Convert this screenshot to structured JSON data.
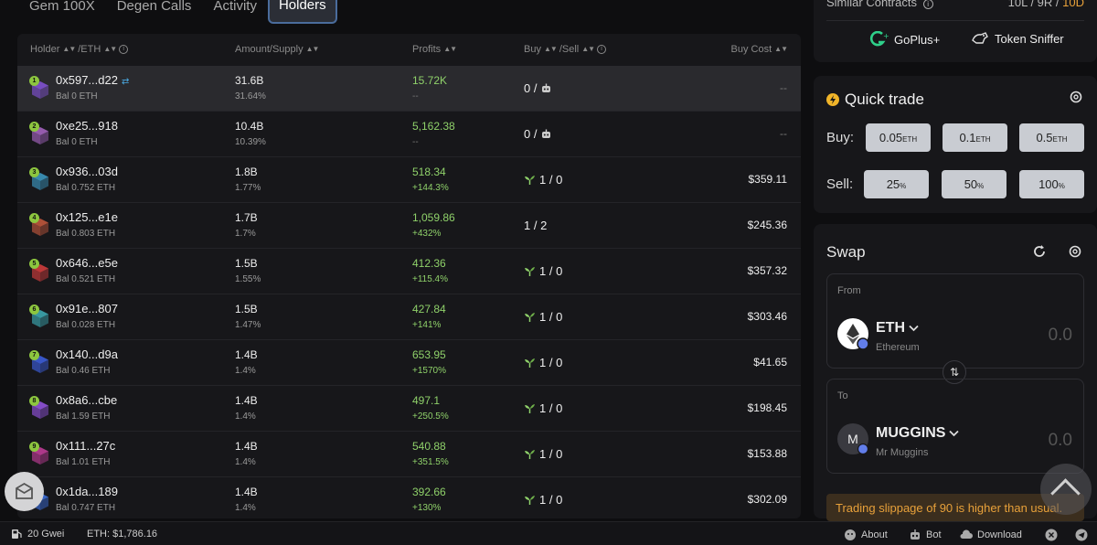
{
  "tabs": [
    {
      "label": "Gem 100X",
      "active": false
    },
    {
      "label": "Degen Calls",
      "active": false
    },
    {
      "label": "Activity",
      "active": false
    },
    {
      "label": "Holders",
      "active": true
    }
  ],
  "table": {
    "headers": {
      "holder": "Holder",
      "eth": "/ETH",
      "amount": "Amount/Supply",
      "profits": "Profits",
      "buy": "Buy",
      "sell": "/Sell",
      "buy_cost": "Buy Cost"
    },
    "rows": [
      {
        "rank": "1",
        "address": "0x597...d22",
        "bal": "Bal 0 ETH",
        "amount": "31.6B",
        "pct": "31.64%",
        "profit": "15.72K",
        "profit_pct": "--",
        "buysell": "0 / ",
        "cost": "--",
        "sprout": false,
        "bot": true,
        "color": "#7b4fc8"
      },
      {
        "rank": "2",
        "address": "0xe25...918",
        "bal": "Bal 0 ETH",
        "amount": "10.4B",
        "pct": "10.39%",
        "profit": "5,162.38",
        "profit_pct": "--",
        "buysell": "0 / ",
        "cost": "--",
        "sprout": false,
        "bot": true,
        "color": "#9c5fb5"
      },
      {
        "rank": "3",
        "address": "0x936...03d",
        "bal": "Bal 0.752 ETH",
        "amount": "1.8B",
        "pct": "1.77%",
        "profit": "518.34",
        "profit_pct": "+144.3%",
        "buysell": "1 / 0",
        "cost": "$359.11",
        "sprout": true,
        "bot": false,
        "color": "#3a8fb5"
      },
      {
        "rank": "4",
        "address": "0x125...e1e",
        "bal": "Bal 0.803 ETH",
        "amount": "1.7B",
        "pct": "1.7%",
        "profit": "1,059.86",
        "profit_pct": "+432%",
        "buysell": "1 / 2",
        "cost": "$245.36",
        "sprout": false,
        "bot": false,
        "color": "#b5533a"
      },
      {
        "rank": "5",
        "address": "0x646...e5e",
        "bal": "Bal 0.521 ETH",
        "amount": "1.5B",
        "pct": "1.55%",
        "profit": "412.36",
        "profit_pct": "+115.4%",
        "buysell": "1 / 0",
        "cost": "$357.32",
        "sprout": true,
        "bot": false,
        "color": "#c53a3a"
      },
      {
        "rank": "6",
        "address": "0x91e...807",
        "bal": "Bal 0.028 ETH",
        "amount": "1.5B",
        "pct": "1.47%",
        "profit": "427.84",
        "profit_pct": "+141%",
        "buysell": "1 / 0",
        "cost": "$303.46",
        "sprout": true,
        "bot": false,
        "color": "#3a9fa8"
      },
      {
        "rank": "7",
        "address": "0x140...d9a",
        "bal": "Bal 0.46 ETH",
        "amount": "1.4B",
        "pct": "1.4%",
        "profit": "653.95",
        "profit_pct": "+1570%",
        "buysell": "1 / 0",
        "cost": "$41.65",
        "sprout": true,
        "bot": false,
        "color": "#3a5ad0"
      },
      {
        "rank": "8",
        "address": "0x8a6...cbe",
        "bal": "Bal 1.59 ETH",
        "amount": "1.4B",
        "pct": "1.4%",
        "profit": "497.1",
        "profit_pct": "+250.5%",
        "buysell": "1 / 0",
        "cost": "$198.45",
        "sprout": true,
        "bot": false,
        "color": "#8a4fd0"
      },
      {
        "rank": "9",
        "address": "0x111...27c",
        "bal": "Bal 1.01 ETH",
        "amount": "1.4B",
        "pct": "1.4%",
        "profit": "540.88",
        "profit_pct": "+351.5%",
        "buysell": "1 / 0",
        "cost": "$153.88",
        "sprout": true,
        "bot": false,
        "color": "#b53a8f"
      },
      {
        "rank": "10",
        "address": "0x1da...189",
        "bal": "Bal 0.747 ETH",
        "amount": "1.4B",
        "pct": "1.4%",
        "profit": "392.66",
        "profit_pct": "+130%",
        "buysell": "1 / 0",
        "cost": "$302.09",
        "sprout": true,
        "bot": false,
        "color": "#3a6ad0"
      }
    ]
  },
  "similar": {
    "label": "Similar Contracts",
    "l": "10L",
    "r": "9R",
    "d": "10D"
  },
  "tools": {
    "goplus": "GoPlus+",
    "sniffer": "Token Sniffer"
  },
  "quick_trade": {
    "title": "Quick trade",
    "buy_label": "Buy:",
    "sell_label": "Sell:",
    "buy": [
      {
        "amount": "0.05",
        "unit": "ETH"
      },
      {
        "amount": "0.1",
        "unit": "ETH"
      },
      {
        "amount": "0.5",
        "unit": "ETH"
      }
    ],
    "sell": [
      {
        "amount": "25",
        "unit": "%"
      },
      {
        "amount": "50",
        "unit": "%"
      },
      {
        "amount": "100",
        "unit": "%"
      }
    ]
  },
  "swap": {
    "title": "Swap",
    "from": {
      "label": "From",
      "symbol": "ETH",
      "name": "Ethereum",
      "value": "0.0"
    },
    "to": {
      "label": "To",
      "symbol": "MUGGINS",
      "name": "Mr Muggins",
      "value": "0.0",
      "icon_letter": "M"
    },
    "warning": "Trading slippage of 90 is higher than usual."
  },
  "bottom": {
    "gas": "20 Gwei",
    "eth_price": "ETH: $1,786.16",
    "about": "About",
    "bot": "Bot",
    "download": "Download"
  },
  "colors": {
    "accent_green": "#8fd16a",
    "warning": "#e8a13a",
    "tab_border": "#4a6c9c"
  }
}
